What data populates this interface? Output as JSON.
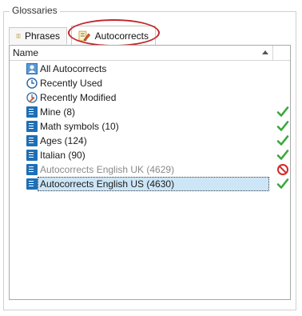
{
  "group_title": "Glossaries",
  "tabs": [
    {
      "label": "Phrases",
      "icon": "phrases-icon",
      "active": false
    },
    {
      "label": "Autocorrects",
      "icon": "autocorrects-icon",
      "active": true
    }
  ],
  "list": {
    "column_header": "Name",
    "sort": "ascending",
    "items": [
      {
        "label": "All Autocorrects",
        "icon": "contacts-icon",
        "status": null,
        "disabled": false
      },
      {
        "label": "Recently Used",
        "icon": "clock-icon",
        "status": null,
        "disabled": false
      },
      {
        "label": "Recently Modified",
        "icon": "recent-modified-icon",
        "status": null,
        "disabled": false
      },
      {
        "label": "Mine (8)",
        "icon": "glossary-book-icon",
        "status": "enabled",
        "disabled": false
      },
      {
        "label": "Math symbols (10)",
        "icon": "glossary-book-icon",
        "status": "enabled",
        "disabled": false
      },
      {
        "label": "Ages (124)",
        "icon": "glossary-book-icon",
        "status": "enabled",
        "disabled": false
      },
      {
        "label": "Italian (90)",
        "icon": "glossary-book-icon",
        "status": "enabled",
        "disabled": false
      },
      {
        "label": "Autocorrects English UK (4629)",
        "icon": "glossary-book-icon",
        "status": "blocked",
        "disabled": true
      },
      {
        "label": "Autocorrects English US (4630)",
        "icon": "glossary-book-icon",
        "status": "enabled",
        "disabled": false,
        "selected": true
      }
    ]
  },
  "colors": {
    "accent_blue": "#1f6fb5",
    "check_green": "#3aa83a",
    "blocked_red": "#d02b2b",
    "selection": "#cde6f7",
    "annotation_red": "#c0282d"
  }
}
